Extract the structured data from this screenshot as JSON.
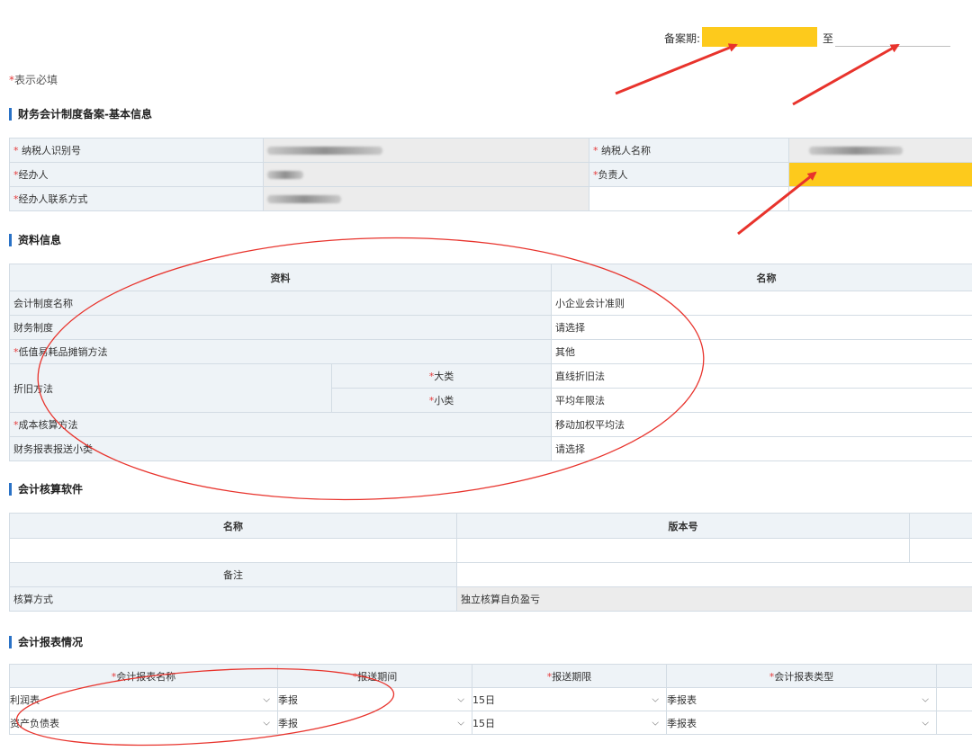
{
  "filing_period": {
    "label": "备案期:",
    "start_value": "",
    "to_label": "至",
    "end_value": ""
  },
  "required_note": {
    "asterisk": "*",
    "text": "表示必填"
  },
  "basic_info": {
    "title": "财务会计制度备案-基本信息",
    "rows": [
      {
        "label1": "纳税人识别号",
        "label1_prefix": "* ",
        "label2": "纳税人名称",
        "label2_prefix": "* "
      },
      {
        "label1": "经办人",
        "label1_prefix": "*",
        "label2": "负责人",
        "label2_prefix": "*"
      },
      {
        "label1": "经办人联系方式",
        "label1_prefix": "*"
      }
    ]
  },
  "materials": {
    "title": "资料信息",
    "headers": {
      "col1": "资料",
      "col2": "名称"
    },
    "rows": {
      "accounting_system_name": {
        "label": "会计制度名称",
        "value": "小企业会计准则"
      },
      "financial_system": {
        "label": "财务制度",
        "value": "请选择"
      },
      "low_value_amortization": {
        "prefix": "*",
        "label": "低值易耗品摊销方法",
        "value": "其他"
      },
      "depreciation": {
        "label": "折旧方法",
        "major": {
          "prefix": "*",
          "label": "大类",
          "value": "直线折旧法"
        },
        "minor": {
          "prefix": "*",
          "label": "小类",
          "value": "平均年限法"
        }
      },
      "cost_accounting": {
        "prefix": "*",
        "label": "成本核算方法",
        "value": "移动加权平均法"
      },
      "report_subcategory": {
        "label": "财务报表报送小类",
        "value": "请选择"
      }
    }
  },
  "software": {
    "title": "会计核算软件",
    "headers": {
      "name": "名称",
      "version": "版本号"
    },
    "remarks_label": "备注",
    "method_label": "核算方式",
    "method_value": "独立核算自负盈亏"
  },
  "reports": {
    "title": "会计报表情况",
    "headers": [
      {
        "prefix": "*",
        "label": "会计报表名称"
      },
      {
        "prefix": "*",
        "label": "报送期间"
      },
      {
        "prefix": "*",
        "label": "报送期限"
      },
      {
        "prefix": "*",
        "label": "会计报表类型"
      }
    ],
    "rows": [
      {
        "name": "利润表",
        "period": "季报",
        "deadline": "15日",
        "type": "季报表"
      },
      {
        "name": "资产负债表",
        "period": "季报",
        "deadline": "15日",
        "type": "季报表"
      }
    ]
  },
  "colors": {
    "highlight": "#fdca1c",
    "annotation": "#e8332c",
    "accent": "#2a72c6"
  },
  "icons": {
    "dropdown": "chevron-down-icon"
  }
}
